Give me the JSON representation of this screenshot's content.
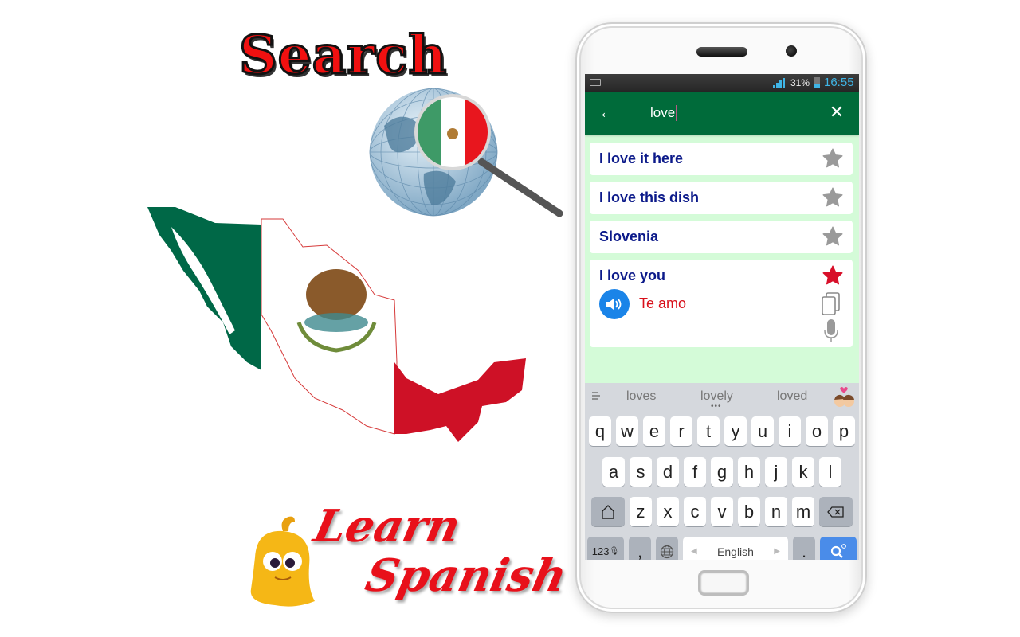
{
  "promo": {
    "headline": "Search",
    "brand_line1": "Learn",
    "brand_line2": "Spanish",
    "colors": {
      "flag_green": "#006847",
      "flag_white": "#ffffff",
      "flag_red": "#ce1126",
      "headline_red": "#f01010"
    }
  },
  "status_bar": {
    "battery_percent": "31%",
    "time": "16:55",
    "icons": [
      "keyboard-icon",
      "signal-icon",
      "battery-icon"
    ]
  },
  "app_bar": {
    "back_icon": "arrow-left-icon",
    "search_value": "love",
    "clear_icon": "close-icon",
    "color": "#006b3a"
  },
  "results": [
    {
      "phrase": "I love it here",
      "favorite": false
    },
    {
      "phrase": "I love this dish",
      "favorite": false
    },
    {
      "phrase": "Slovenia",
      "favorite": false
    },
    {
      "phrase": "I love you",
      "favorite": true,
      "translation": "Te amo",
      "expanded": true
    }
  ],
  "keyboard": {
    "suggestions": [
      "loves",
      "lovely",
      "loved"
    ],
    "rows": [
      [
        "q",
        "w",
        "e",
        "r",
        "t",
        "y",
        "u",
        "i",
        "o",
        "p"
      ],
      [
        "a",
        "s",
        "d",
        "f",
        "g",
        "h",
        "j",
        "k",
        "l"
      ],
      [
        "z",
        "x",
        "c",
        "v",
        "b",
        "n",
        "m"
      ]
    ],
    "numbers_key": "123",
    "comma_key": ",",
    "space_label": "English",
    "period_key": "."
  }
}
